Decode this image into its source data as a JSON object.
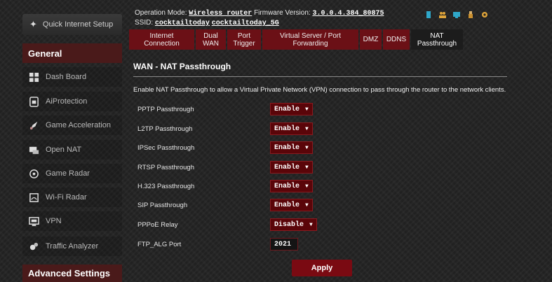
{
  "header": {
    "op_mode_label": "Operation Mode:",
    "op_mode_value": "Wireless router",
    "fw_label": "Firmware Version:",
    "fw_value": "3.0.0.4.384_80875",
    "ssid_label": "SSID:",
    "ssid_1": "cocktailtoday",
    "ssid_2": "cocktailtoday_5G",
    "status_icons": [
      "sim-icon",
      "users-icon",
      "network-icon",
      "usb-icon",
      "settings-icon"
    ]
  },
  "sidebar": {
    "quick_setup": "Quick Internet Setup",
    "general_head": "General",
    "items": [
      {
        "label": "Dash Board",
        "icon": "dashboard-icon"
      },
      {
        "label": "AiProtection",
        "icon": "lock-icon"
      },
      {
        "label": "Game Acceleration",
        "icon": "rocket-icon"
      },
      {
        "label": "Open NAT",
        "icon": "open-nat-icon"
      },
      {
        "label": "Game Radar",
        "icon": "radar-icon"
      },
      {
        "label": "Wi-Fi Radar",
        "icon": "wifi-radar-icon"
      },
      {
        "label": "VPN",
        "icon": "vpn-icon"
      },
      {
        "label": "Traffic Analyzer",
        "icon": "analyzer-icon"
      }
    ],
    "advanced_head": "Advanced Settings"
  },
  "tabs": [
    {
      "label": "Internet Connection",
      "active": false
    },
    {
      "label": "Dual WAN",
      "active": false
    },
    {
      "label": "Port Trigger",
      "active": false
    },
    {
      "label": "Virtual Server / Port Forwarding",
      "active": false
    },
    {
      "label": "DMZ",
      "active": false
    },
    {
      "label": "DDNS",
      "active": false
    },
    {
      "label": "NAT Passthrough",
      "active": true
    }
  ],
  "main": {
    "title": "WAN - NAT Passthrough",
    "description": "Enable NAT Passthrough to allow a Virtual Private Network (VPN) connection to pass through the router to the network clients.",
    "settings": [
      {
        "label": "PPTP Passthrough",
        "value": "Enable"
      },
      {
        "label": "L2TP Passthrough",
        "value": "Enable"
      },
      {
        "label": "IPSec Passthrough",
        "value": "Enable"
      },
      {
        "label": "RTSP Passthrough",
        "value": "Enable"
      },
      {
        "label": "H.323 Passthrough",
        "value": "Enable"
      },
      {
        "label": "SIP Passthrough",
        "value": "Enable"
      },
      {
        "label": "PPPoE Relay",
        "value": "Disable"
      }
    ],
    "ftp_label": "FTP_ALG Port",
    "ftp_value": "2021",
    "apply_label": "Apply"
  },
  "colors": {
    "accent": "#6b1016",
    "select_bg": "#5a0509",
    "button": "#7a0a12"
  }
}
